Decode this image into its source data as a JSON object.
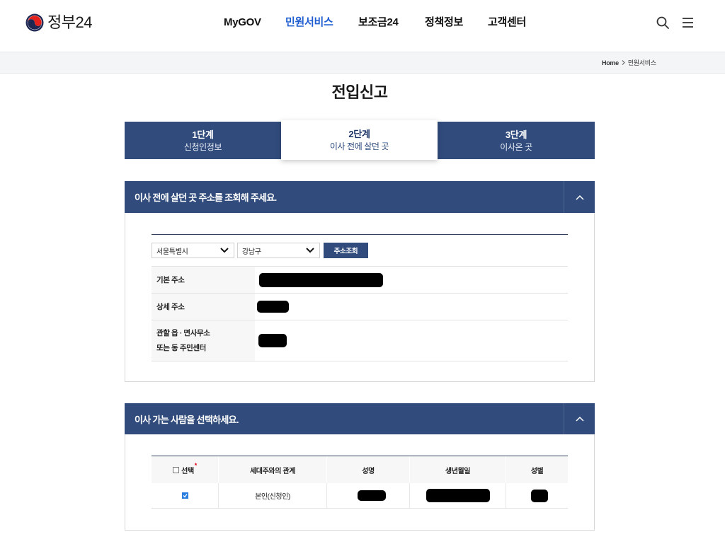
{
  "colors": {
    "navy": "#304b7c",
    "accent_blue": "#1f5ed1",
    "checkbox_blue": "#2a7de1",
    "required_red": "#e60012",
    "text_dark": "#222222"
  },
  "header": {
    "logo_icon": "government-emblem-icon",
    "logo_text": "정부24",
    "nav": [
      {
        "label": "MyGOV",
        "active": false
      },
      {
        "label": "민원서비스",
        "active": true
      },
      {
        "label": "보조금24",
        "active": false
      },
      {
        "label": "정책정보",
        "active": false
      },
      {
        "label": "고객센터",
        "active": false
      }
    ],
    "search_icon": "search-icon",
    "menu_icon": "hamburger-menu-icon"
  },
  "breadcrumb": {
    "home": "Home",
    "separator_icon": "chevron-right-icon",
    "current": "민원서비스"
  },
  "page_title": "전입신고",
  "steps": [
    {
      "step": "1단계",
      "label": "신청인정보",
      "active": false
    },
    {
      "step": "2단계",
      "label": "이사 전에 살던 곳",
      "active": true
    },
    {
      "step": "3단계",
      "label": "이사온 곳",
      "active": false
    }
  ],
  "address_section": {
    "title": "이사 전에 살던 곳 주소를 조회해 주세요.",
    "toggle_icon": "chevron-up-icon",
    "city_select": {
      "value": "서울특별시"
    },
    "district_select": {
      "value": "강남구"
    },
    "search_button_label": "주소조회",
    "rows": [
      {
        "label": "기본 주소"
      },
      {
        "label": "상세 주소"
      },
      {
        "label_lines": [
          "관할 읍 · 면사무소",
          "또는 동 주민센터"
        ]
      }
    ]
  },
  "mover_section": {
    "title": "이사 가는 사람을 선택하세요.",
    "toggle_icon": "chevron-up-icon",
    "select_all_checked": false,
    "required_mark": "*",
    "columns": [
      "선택",
      "세대주와의 관계",
      "성명",
      "생년월일",
      "성별"
    ],
    "rows": [
      {
        "checked": true,
        "relation": "본인(신청인)"
      }
    ]
  }
}
